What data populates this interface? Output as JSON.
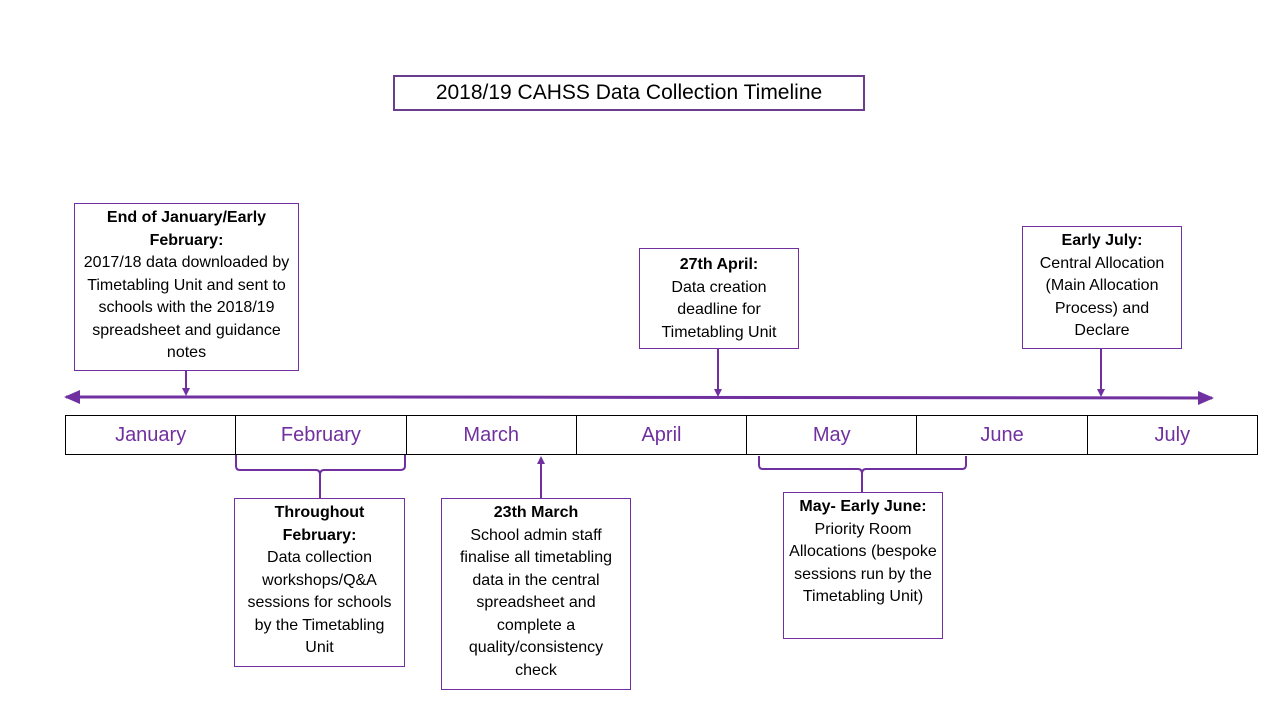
{
  "title": "2018/19  CAHSS Data Collection Timeline",
  "colors": {
    "accent": "#7030a0",
    "border": "#000000"
  },
  "months": [
    "January",
    "February",
    "March",
    "April",
    "May",
    "June",
    "July"
  ],
  "events_above": [
    {
      "heading": "End of January/Early February:",
      "body": "2017/18 data downloaded by Timetabling Unit and sent to schools with the 2018/19 spreadsheet and guidance notes"
    },
    {
      "heading": "27th April:",
      "body": "Data creation deadline for Timetabling Unit"
    },
    {
      "heading": "Early July:",
      "body": "Central Allocation (Main Allocation Process) and Declare"
    }
  ],
  "events_below": [
    {
      "heading": "Throughout February:",
      "body": "Data collection workshops/Q&A sessions for schools by the Timetabling Unit"
    },
    {
      "heading": "23th March",
      "body": "School admin staff finalise all timetabling data in the central spreadsheet and complete a quality/consistency check"
    },
    {
      "heading": "May- Early June:",
      "body": "Priority Room Allocations (bespoke sessions run by the Timetabling Unit)"
    }
  ]
}
